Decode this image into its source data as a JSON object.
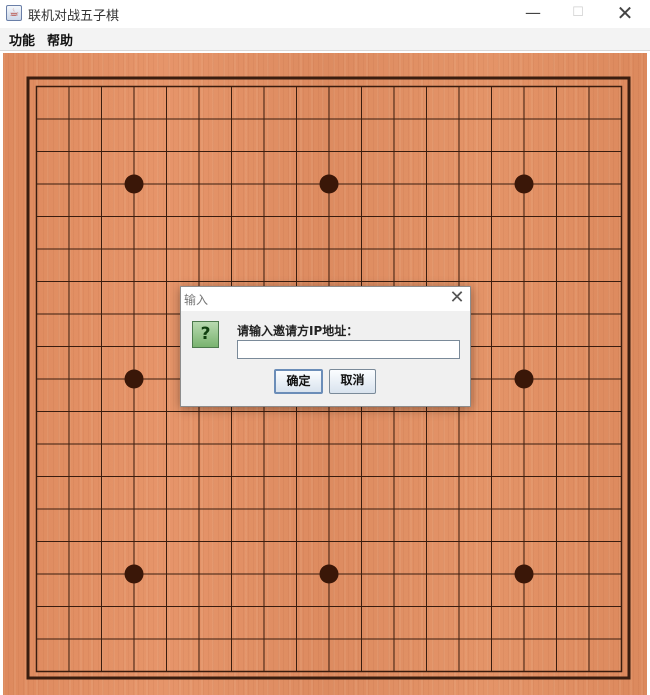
{
  "window": {
    "title": "联机对战五子棋",
    "icon": "java-cup-icon"
  },
  "menu": {
    "items": [
      "功能",
      "帮助"
    ]
  },
  "board": {
    "grid_lines": 19,
    "star_points": [
      [
        3,
        3
      ],
      [
        9,
        3
      ],
      [
        15,
        3
      ],
      [
        3,
        9
      ],
      [
        9,
        9
      ],
      [
        15,
        9
      ],
      [
        3,
        15
      ],
      [
        9,
        15
      ],
      [
        15,
        15
      ]
    ],
    "line_color": "#3a1d0f",
    "wood_color": "#e08f63"
  },
  "dialog": {
    "title": "输入",
    "icon": "question-icon",
    "prompt": "请输入邀请方IP地址：",
    "input_value": "",
    "ok_label": "确定",
    "cancel_label": "取消"
  }
}
